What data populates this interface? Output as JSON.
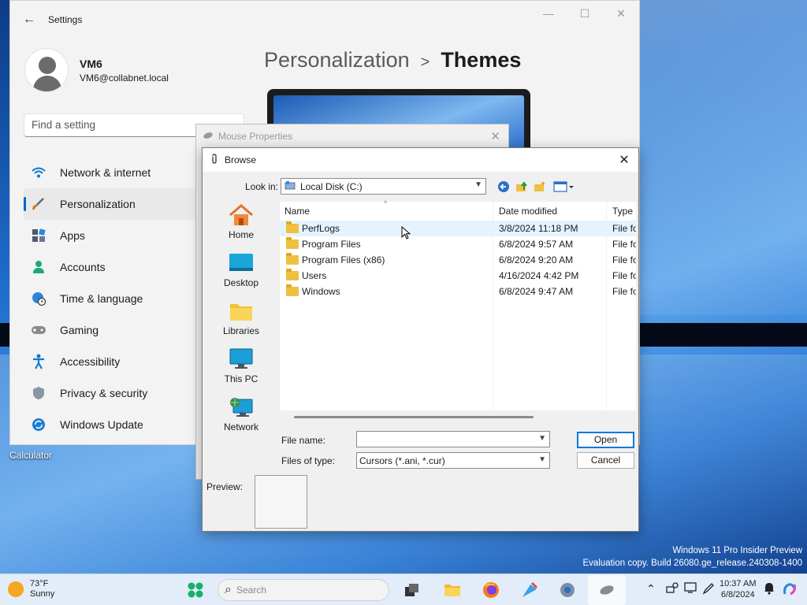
{
  "desktop": {
    "calculator_label": "Calculator",
    "watermark_line1": "Windows 11 Pro Insider Preview",
    "watermark_line2": "Evaluation copy. Build 26080.ge_release.240308-1400"
  },
  "settings": {
    "title": "Settings",
    "user": {
      "name": "VM6",
      "email": "VM6@collabnet.local"
    },
    "search_placeholder": "Find a setting",
    "breadcrumb": {
      "parent": "Personalization",
      "separator": ">",
      "current": "Themes"
    },
    "nav": [
      {
        "label": "Network & internet",
        "icon": "wifi-icon",
        "color": "#0078d4"
      },
      {
        "label": "Personalization",
        "icon": "brush-icon",
        "color": "#d0761c",
        "active": true
      },
      {
        "label": "Apps",
        "icon": "apps-icon",
        "color": "#505a70"
      },
      {
        "label": "Accounts",
        "icon": "person-icon",
        "color": "#1ea879"
      },
      {
        "label": "Time & language",
        "icon": "globe-clock-icon",
        "color": "#2b86d9"
      },
      {
        "label": "Gaming",
        "icon": "gamepad-icon",
        "color": "#7a7a7a"
      },
      {
        "label": "Accessibility",
        "icon": "accessibility-icon",
        "color": "#1278d6"
      },
      {
        "label": "Privacy & security",
        "icon": "shield-icon",
        "color": "#7a8696"
      },
      {
        "label": "Windows Update",
        "icon": "update-icon",
        "color": "#1a7ed6"
      }
    ]
  },
  "mouse_properties": {
    "title": "Mouse Properties"
  },
  "browse": {
    "title": "Browse",
    "look_in_label": "Look in:",
    "look_in_value": "Local Disk (C:)",
    "places": [
      {
        "label": "Home",
        "icon": "home-icon"
      },
      {
        "label": "Desktop",
        "icon": "desktop-icon"
      },
      {
        "label": "Libraries",
        "icon": "libraries-icon"
      },
      {
        "label": "This PC",
        "icon": "this-pc-icon"
      },
      {
        "label": "Network",
        "icon": "network-icon"
      }
    ],
    "columns": {
      "name": "Name",
      "date": "Date modified",
      "type": "Type"
    },
    "files": [
      {
        "name": "PerfLogs",
        "date": "3/8/2024 11:18 PM",
        "type": "File fo"
      },
      {
        "name": "Program Files",
        "date": "6/8/2024 9:57 AM",
        "type": "File fo"
      },
      {
        "name": "Program Files (x86)",
        "date": "6/8/2024 9:20 AM",
        "type": "File fo"
      },
      {
        "name": "Users",
        "date": "4/16/2024 4:42 PM",
        "type": "File fo"
      },
      {
        "name": "Windows",
        "date": "6/8/2024 9:47 AM",
        "type": "File fo"
      }
    ],
    "file_name_label": "File name:",
    "file_name_value": "",
    "file_type_label": "Files of type:",
    "file_type_value": "Cursors (*.ani, *.cur)",
    "open_label": "Open",
    "cancel_label": "Cancel",
    "preview_label": "Preview:"
  },
  "taskbar": {
    "weather_temp": "73°F",
    "weather_desc": "Sunny",
    "search_placeholder": "Search",
    "time": "10:37 AM",
    "date": "6/8/2024"
  }
}
